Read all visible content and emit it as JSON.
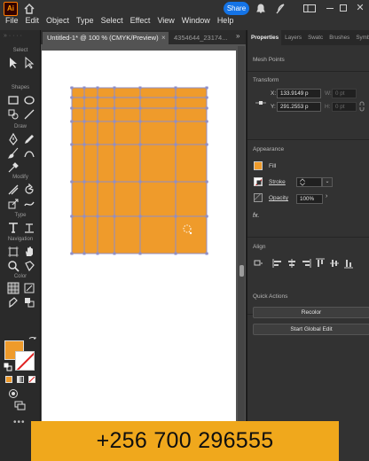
{
  "app": {
    "logo_text": "Ai",
    "menu": [
      "File",
      "Edit",
      "Object",
      "Type",
      "Select",
      "Effect",
      "View",
      "Window",
      "Help"
    ],
    "share_label": "Share",
    "close_glyph": "✕"
  },
  "toolbar": {
    "sections": [
      "Select",
      "Shapes",
      "Draw",
      "Modify",
      "Type",
      "Navigation",
      "Color"
    ],
    "more_glyph": "•••",
    "fill_color": "#ef9b2b"
  },
  "document": {
    "active_tab": "Untitled-1* @ 100 % (CMYK/Preview)",
    "active_tab_close": "×",
    "inactive_tab": "4354644_23174...",
    "tab_more": "»",
    "mesh_fill": "#ef9b2b",
    "mesh_line_color": "#8e8ec8"
  },
  "panel": {
    "tabs": [
      "Properties",
      "Layers",
      "Swatc",
      "Brushes",
      "Symbo"
    ],
    "selection_label": "Mesh Points",
    "transform": {
      "heading": "Transform",
      "x_label": "X:",
      "x_value": "133.9149 p",
      "y_label": "Y:",
      "y_value": "291.2553 p",
      "w_label": "W:",
      "w_value": "0 pt",
      "h_label": "H:",
      "h_value": "0 pt"
    },
    "appearance": {
      "heading": "Appearance",
      "fill_label": "Fill",
      "fill_color": "#ef9b2b",
      "stroke_label": "Stroke",
      "stroke_dropdown_glyph": "⌄",
      "opacity_label": "Opacity",
      "opacity_value": "100%",
      "opacity_arrow_glyph": "›",
      "fx_label": "fx."
    },
    "align": {
      "heading": "Align"
    },
    "quick_actions": {
      "heading": "Quick Actions",
      "recolor_label": "Recolor",
      "global_edit_label": "Start Global Edit"
    }
  },
  "banner": {
    "phone": "+256 700 296555",
    "color": "#f0a81c"
  }
}
